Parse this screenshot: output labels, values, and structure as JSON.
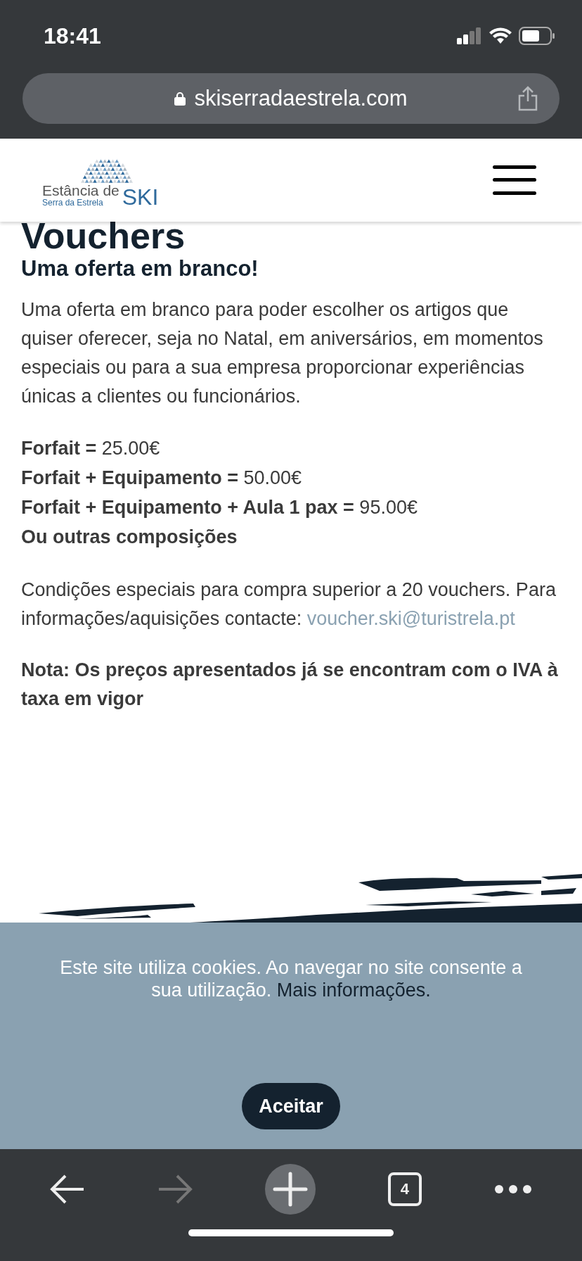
{
  "status_bar": {
    "time": "18:41"
  },
  "browser": {
    "url": "skiserradaestrela.com"
  },
  "site_header": {
    "logo": {
      "line_1": "Estância de",
      "line_2": "Serra da Estrela",
      "mark": "SKI"
    }
  },
  "page": {
    "title": "Vouchers",
    "subtitle": "Uma oferta em branco!",
    "intro": "Uma oferta em branco para poder escolher os artigos que quiser oferecer, seja no Natal, em aniversários, em momentos especiais ou para a sua empresa proporcionar experiências únicas a clientes ou funcionários.",
    "prices": [
      {
        "text": "**Forfait =** 25.00€"
      },
      {
        "text": "**Forfait + Equipamento =** 50.00€"
      },
      {
        "text": "**Forfait + Equipamento + Aula 1 pax =** 95.00€"
      }
    ],
    "other_options": "Ou outras composições",
    "conditions": "Condições especiais para compra superior a 20 vouchers. Para informações/aquisições contacte:",
    "contact_link": "voucher.ski@turistrela.pt",
    "note": "Nota: Os preços apresentados já se encontram com o IVA à taxa em vigor"
  },
  "cookie_banner": {
    "text": "Este site utiliza cookies. Ao navegar no site consente a sua utilização.",
    "link": "Mais informações.",
    "button": "Aceitar"
  },
  "toolbar": {
    "back": {
      "disabled": false
    },
    "forward": {
      "disabled": true
    },
    "tabs_count": "4"
  }
}
